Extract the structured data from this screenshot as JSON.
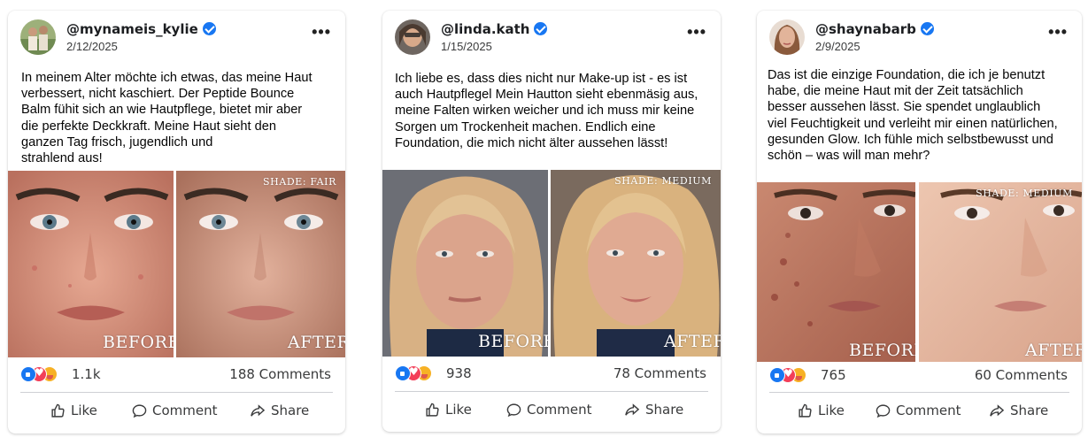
{
  "posts": [
    {
      "username": "@mynameis_kylie",
      "date": "2/12/2025",
      "text": "In meinem Alter möchte ich etwas, das meine Haut\nverbessert, nicht kaschiert. Der Peptide Bounce\nBalm fühit sich an wie Hautpflege, bietet mir aber\ndie perfekte  Deckkraft. Meine Haut sieht den\nganzen Tag frisch, jugendlich und\nstrahlend aus!",
      "shade": "SHADE: FAIR",
      "before_label": "BEFORE",
      "after_label": "AFTER",
      "reactions": "1.1k",
      "comments": "188 Comments"
    },
    {
      "username": "@linda.kath",
      "date": "1/15/2025",
      "text": "Ich liebe es, dass dies nicht nur Make-up ist - es ist\nauch Hautpflegel Mein Hautton sieht ebenmäsig aus,\nmeine Falten wirken weicher und ich muss mir keine\nSorgen um Trockenheit machen. Endlich eine\nFoundation, die mich nicht älter aussehen lässt!",
      "shade": "SHADE: MEDIUM",
      "before_label": "BEFORE",
      "after_label": "AFTER",
      "reactions": "938",
      "comments": "78 Comments"
    },
    {
      "username": "@shaynabarb",
      "date": "2/9/2025",
      "text": "Das ist die einzige Foundation, die ich je benutzt\nhabe, die meine Haut mit der Zeit tatsächlich\nbesser aussehen lässt. Sie spendet unglaublich\nviel Feuchtigkeit und verleiht mir einen natürlichen,\ngesunden Glow. Ich fühle mich selbstbewusst und\nschön – was will man mehr?",
      "shade": "SHADE: MEDIUM",
      "before_label": "BEFORE",
      "after_label": "AFTER",
      "reactions": "765",
      "comments": "60 Comments"
    }
  ],
  "actions": {
    "like": "Like",
    "comment": "Comment",
    "share": "Share"
  },
  "icons": {
    "more": "more-options-icon",
    "verified": "verified-badge-icon",
    "like": "thumbs-up-icon",
    "comment": "comment-bubble-icon",
    "share": "share-arrow-icon",
    "reactions": [
      "like-reaction-icon",
      "love-reaction-icon",
      "care-reaction-icon"
    ]
  },
  "colors": {
    "verified": "#1877f2",
    "like": "#1877f2",
    "love": "#f33e58",
    "care": "#f7b125",
    "text_secondary": "#3a3b3c"
  }
}
